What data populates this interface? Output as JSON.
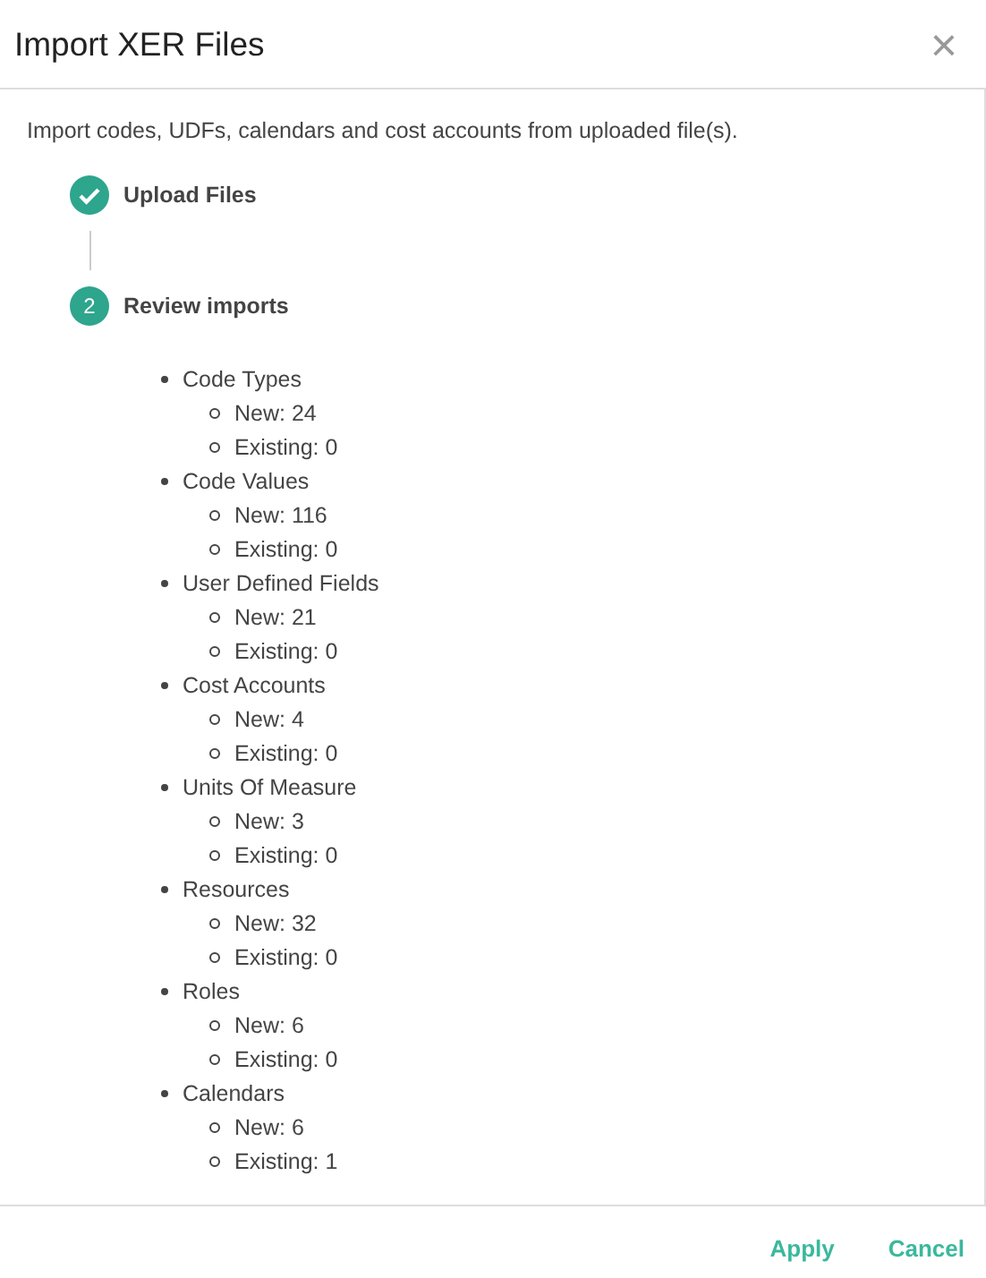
{
  "dialog": {
    "title": "Import XER Files",
    "close": "×"
  },
  "description": "Import codes, UDFs, calendars and cost accounts from uploaded file(s).",
  "steps": [
    {
      "label": "Upload Files",
      "completed": true
    },
    {
      "label": "Review imports",
      "completed": false,
      "number": "2"
    }
  ],
  "imports": [
    {
      "name": "Code Types",
      "children": [
        "New: 24",
        "Existing: 0"
      ]
    },
    {
      "name": "Code Values",
      "children": [
        "New: 116",
        "Existing: 0"
      ]
    },
    {
      "name": "User Defined Fields",
      "children": [
        "New: 21",
        "Existing: 0"
      ]
    },
    {
      "name": "Cost Accounts",
      "children": [
        "New: 4",
        "Existing: 0"
      ]
    },
    {
      "name": "Units Of Measure",
      "children": [
        "New: 3",
        "Existing: 0"
      ]
    },
    {
      "name": "Resources",
      "children": [
        "New: 32",
        "Existing: 0"
      ]
    },
    {
      "name": "Roles",
      "children": [
        "New: 6",
        "Existing: 0"
      ]
    },
    {
      "name": "Calendars",
      "children": [
        "New: 6",
        "Existing: 1"
      ]
    }
  ],
  "buttons": [
    "Apply",
    "Cancel"
  ]
}
